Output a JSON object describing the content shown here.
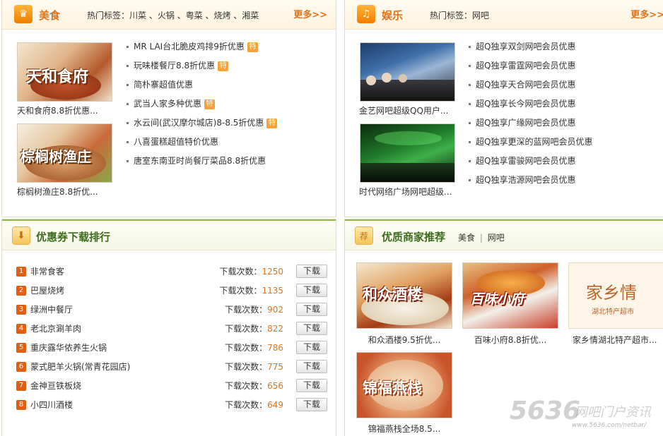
{
  "food": {
    "title": "美食",
    "tags_label": "热门标签：川菜 、火锅 、粤菜 、烧烤 、湘菜",
    "more": "更多>>",
    "thumbs": [
      {
        "caption": "天和食府8.8折优惠...",
        "img_text": "天和食府"
      },
      {
        "caption": "棕榈树渔庄8.8折优...",
        "img_text": "棕榈树渔庄"
      }
    ],
    "items": [
      {
        "label": "MR LAI台北脆皮鸡排9折优惠",
        "special": "特"
      },
      {
        "label": "玩味楼餐厅8.8折优惠",
        "special": "特"
      },
      {
        "label": "简朴寨超值优惠",
        "special": ""
      },
      {
        "label": "武当人家多种优惠",
        "special": "特"
      },
      {
        "label": "水云间(武汉摩尔城店)8-8.5折优惠",
        "special": "特"
      },
      {
        "label": "八喜蛋糕超值特价优惠",
        "special": ""
      },
      {
        "label": "唐室东南亚时尚餐厅菜品8.8折优惠",
        "special": ""
      }
    ]
  },
  "entertainment": {
    "title": "娱乐",
    "tags_label": "热门标签：网吧",
    "more": "更多>>",
    "thumbs": [
      {
        "caption": "金艺网吧超级QQ用户..."
      },
      {
        "caption": "时代网络广场网吧超级..."
      }
    ],
    "items": [
      "超Q独享双剑网吧会员优惠",
      "超Q独享雷霆网吧会员优惠",
      "超Q独享天合网吧会员优惠",
      "超Q独享长今网吧会员优惠",
      "超Q独享广缘网吧会员优惠",
      "超Q独享更深的蓝网吧会员优惠",
      "超Q独享雷骏网吧会员优惠",
      "超Q独享浩源网吧会员优惠"
    ]
  },
  "ranking": {
    "title": "优惠券下载排行",
    "count_label": "下载次数：",
    "download_label": "下载",
    "rows": [
      {
        "rank": "1",
        "name": "非常食客",
        "count": "1250"
      },
      {
        "rank": "2",
        "name": "巴屋烧烤",
        "count": "1135"
      },
      {
        "rank": "3",
        "name": "绿洲中餐厅",
        "count": "902"
      },
      {
        "rank": "4",
        "name": "老北京涮羊肉",
        "count": "822"
      },
      {
        "rank": "5",
        "name": "重庆露华侬养生火锅",
        "count": "786"
      },
      {
        "rank": "6",
        "name": "蒙式肥羊火锅(常青花园店)",
        "count": "775"
      },
      {
        "rank": "7",
        "name": "金神亘铁板烧",
        "count": "656"
      },
      {
        "rank": "8",
        "name": "小四川酒楼",
        "count": "649"
      }
    ]
  },
  "merchants": {
    "title": "优质商家推荐",
    "badge": "荐",
    "tabs": [
      "美食",
      "网吧"
    ],
    "cards": [
      {
        "caption": "和众酒楼9.5折优...",
        "img_text": "和众酒楼"
      },
      {
        "caption": "百味小府8.8折优...",
        "img_text": "百味小府"
      },
      {
        "caption": "家乡情湖北特产超市...",
        "img_text": "家乡情",
        "img_sub": "湖北特产超市"
      },
      {
        "caption": "锦福燕栈全场8.5...",
        "img_text": "锦福燕栈"
      }
    ]
  },
  "watermark": {
    "big": "5636",
    "cn": "网吧门户资讯",
    "url": "www.5636.com/netbar/"
  }
}
